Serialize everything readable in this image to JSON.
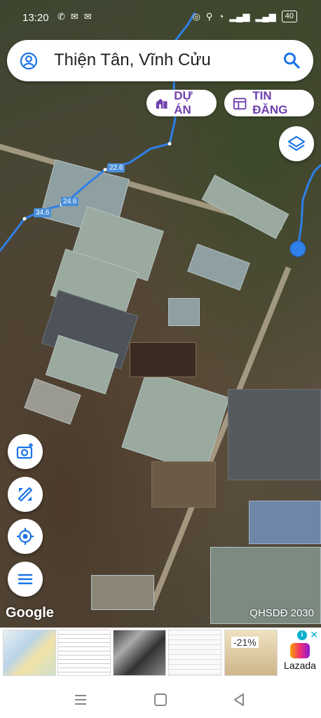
{
  "status_bar": {
    "time": "13:20",
    "battery": "40"
  },
  "search": {
    "query": "Thiện Tân, Vĩnh Cửu"
  },
  "chips": {
    "du_an": "DỰ ÁN",
    "tin_dang": "TIN ĐĂNG"
  },
  "route_labels": [
    "22.6",
    "24.6",
    "34.6"
  ],
  "map": {
    "attribution": "Google",
    "overlay_label": "QHSDĐ 2030"
  },
  "ad": {
    "discount": "-21%",
    "brand": "Lazada"
  },
  "colors": {
    "accent": "#6f3fae",
    "route": "#2f80e8",
    "lazada_gradient": [
      "#f8a100",
      "#f3306f",
      "#8a1bd6"
    ]
  },
  "icons": [
    "whatsapp-icon",
    "gmail-icon",
    "gmail-icon",
    "instagram-icon",
    "location-icon",
    "wifi-icon",
    "signal-icon",
    "layers-icon",
    "camera-add-icon",
    "measure-icon",
    "my-location-icon",
    "menu-icon",
    "search-icon",
    "account-icon"
  ]
}
